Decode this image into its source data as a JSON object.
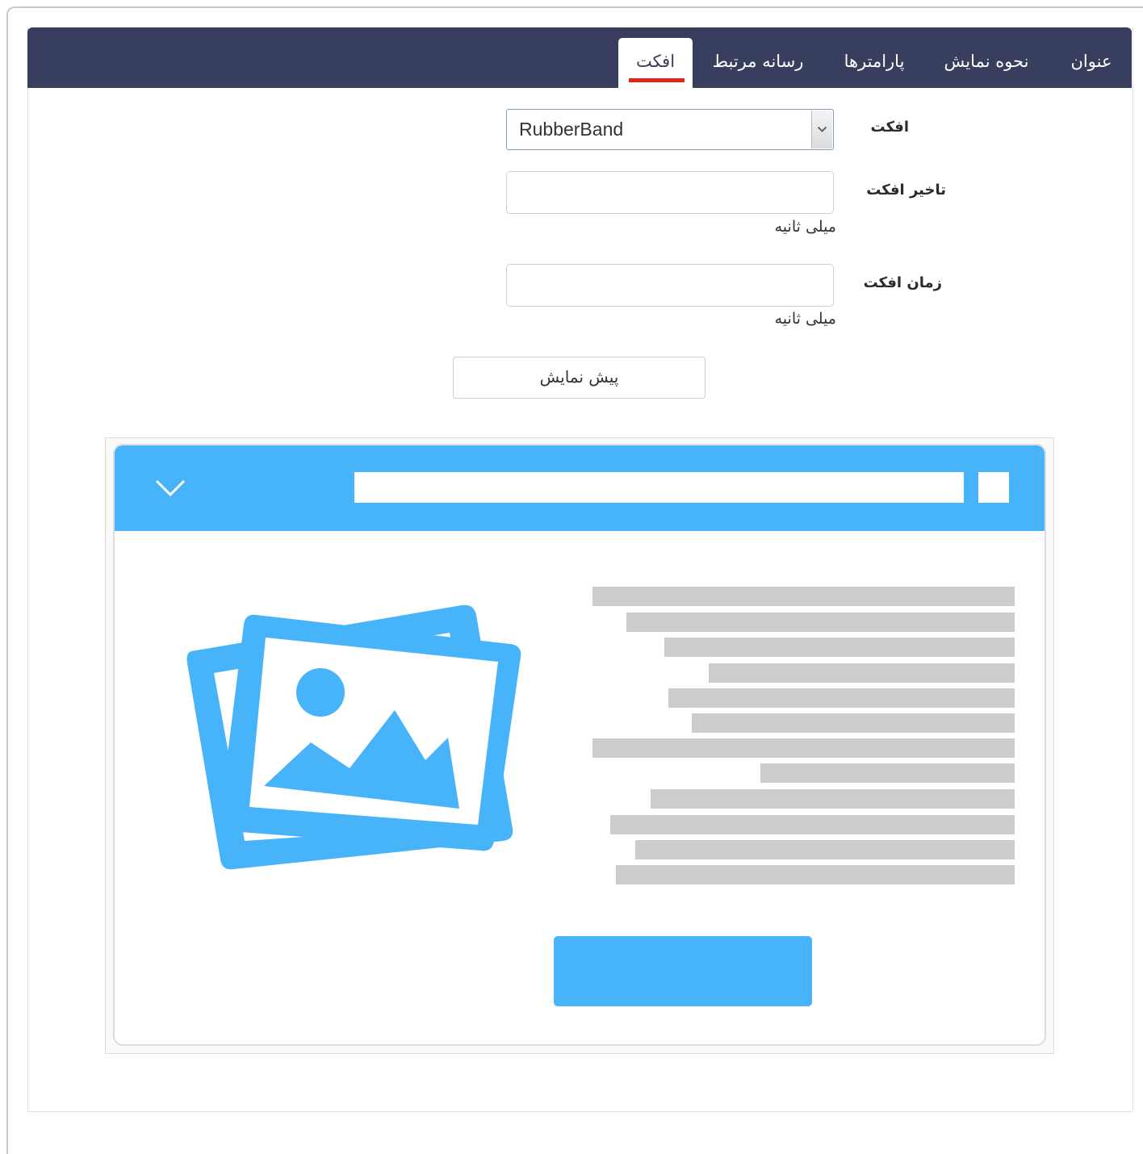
{
  "tabs": [
    {
      "label": "عنوان",
      "active": false
    },
    {
      "label": "نحوه نمایش",
      "active": false
    },
    {
      "label": "پارامترها",
      "active": false
    },
    {
      "label": "رسانه مرتبط",
      "active": false
    },
    {
      "label": "افکت",
      "active": true
    }
  ],
  "form": {
    "effect_label": "افکت",
    "effect_value": "RubberBand",
    "delay_label": "تاخیر افکت",
    "delay_value": "",
    "delay_unit": "میلی ثانیه",
    "duration_label": "زمان افکت",
    "duration_value": "",
    "duration_unit": "میلی ثانیه",
    "preview_button": "پیش نمایش"
  },
  "colors": {
    "tabbar": "#383f5e",
    "active_underline": "#e2231a",
    "preview_accent": "#47b3f8",
    "placeholder_lines": "#cccccc"
  },
  "icons": {
    "select_arrow": "chevron-down-icon",
    "preview_header_arrow": "chevron-down-icon",
    "preview_image": "image-gallery-icon"
  }
}
